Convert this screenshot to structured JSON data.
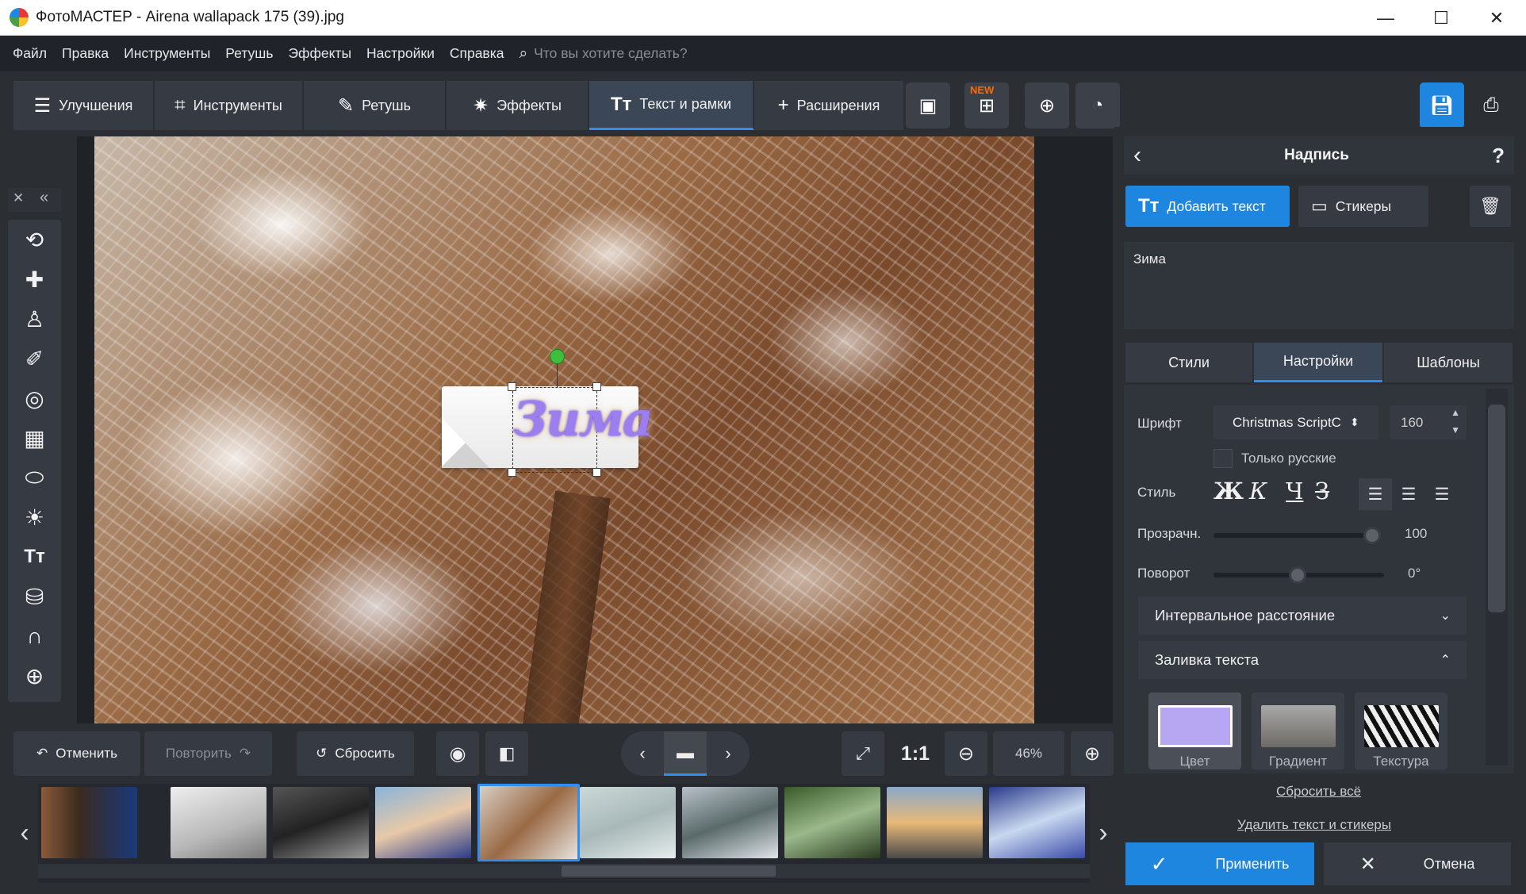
{
  "window": {
    "title": "ФотоМАСТЕР - Airena wallapack 175 (39).jpg",
    "minimize": "—",
    "maximize": "☐",
    "close": "✕"
  },
  "menu": {
    "items": [
      "Файл",
      "Правка",
      "Инструменты",
      "Ретушь",
      "Эффекты",
      "Настройки",
      "Справка"
    ],
    "search_placeholder": "Что вы хотите сделать?"
  },
  "toolbar": {
    "tabs": [
      {
        "label": "Улучшения",
        "icon": "sliders-icon"
      },
      {
        "label": "Инструменты",
        "icon": "crop-icon"
      },
      {
        "label": "Ретушь",
        "icon": "brush-icon"
      },
      {
        "label": "Эффекты",
        "icon": "sparkle-icon"
      },
      {
        "label": "Текст и рамки",
        "icon": "text-icon",
        "active": true
      },
      {
        "label": "Расширения",
        "icon": "plus-icon"
      }
    ],
    "new_badge": "NEW"
  },
  "canvas": {
    "caption": "Зима"
  },
  "bottom": {
    "undo": "Отменить",
    "redo": "Повторить",
    "reset": "Сбросить",
    "one_to_one": "1:1",
    "zoom": "46%"
  },
  "panel": {
    "title": "Надпись",
    "help": "?",
    "add_text": "Добавить текст",
    "stickers": "Стикеры",
    "text_value": "Зима",
    "tabs": [
      "Стили",
      "Настройки",
      "Шаблоны"
    ],
    "active_tab": "Настройки",
    "font_label": "Шрифт",
    "font_value": "Christmas ScriptC",
    "font_size": "160",
    "only_russian": "Только русские",
    "style_label": "Стиль",
    "style_buttons": [
      "Ж",
      "К",
      "Ч",
      "З"
    ],
    "opacity_label": "Прозрачн.",
    "opacity_value": "100",
    "opacity_level": 1.0,
    "rotation_label": "Поворот",
    "rotation_value": "0°",
    "spacing_section": "Интервальное расстояние",
    "fill_section": "Заливка текста",
    "fill_options": [
      "Цвет",
      "Градиент",
      "Текстура"
    ],
    "fill_color": "#b7a6f2",
    "reset_all": "Сбросить всё",
    "delete_all": "Удалить текст и стикеры",
    "apply": "Применить",
    "cancel": "Отмена"
  },
  "colors": {
    "accent": "#1f86e0",
    "bg": "#2b2e33",
    "panel": "#363a42"
  }
}
